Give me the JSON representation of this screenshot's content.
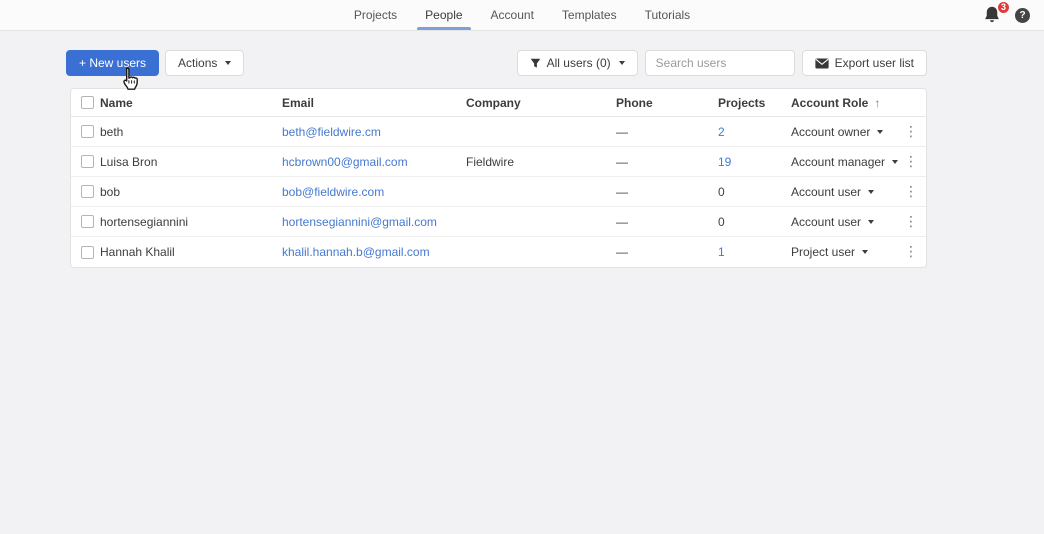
{
  "nav": {
    "tabs": [
      {
        "label": "Projects"
      },
      {
        "label": "People"
      },
      {
        "label": "Account"
      },
      {
        "label": "Templates"
      },
      {
        "label": "Tutorials"
      }
    ],
    "active_tab": "People",
    "notification_count": "3",
    "help_label": "?"
  },
  "toolbar": {
    "new_users_label": "+ New users",
    "actions_label": "Actions",
    "filter_label": "All users (0)",
    "search_placeholder": "Search users",
    "export_label": "Export user list"
  },
  "table": {
    "columns": [
      "Name",
      "Email",
      "Company",
      "Phone",
      "Projects",
      "Account Role"
    ],
    "sort": {
      "column": "Account Role",
      "direction": "ascending",
      "indicator": "↑"
    },
    "rows": [
      {
        "name": "beth",
        "email": "beth@fieldwire.cm",
        "company": "",
        "phone": "—",
        "projects": "2",
        "projects_is_link": true,
        "role": "Account owner"
      },
      {
        "name": "Luisa Bron",
        "email": "hcbrown00@gmail.com",
        "company": "Fieldwire",
        "phone": "—",
        "projects": "19",
        "projects_is_link": true,
        "role": "Account manager"
      },
      {
        "name": "bob",
        "email": "bob@fieldwire.com",
        "company": "",
        "phone": "—",
        "projects": "0",
        "projects_is_link": false,
        "role": "Account user"
      },
      {
        "name": "hortensegiannini",
        "email": "hortensegiannini@gmail.com",
        "company": "",
        "phone": "—",
        "projects": "0",
        "projects_is_link": false,
        "role": "Account user"
      },
      {
        "name": "Hannah Khalil",
        "email": "khalil.hannah.b@gmail.com",
        "company": "",
        "phone": "—",
        "projects": "1",
        "projects_is_link": true,
        "role": "Project user"
      }
    ]
  },
  "colors": {
    "accent_blue": "#3a70d3",
    "link_blue": "#4679cf",
    "badge_red": "#e03b3b",
    "active_tab_underline": "#7f9fd9"
  }
}
